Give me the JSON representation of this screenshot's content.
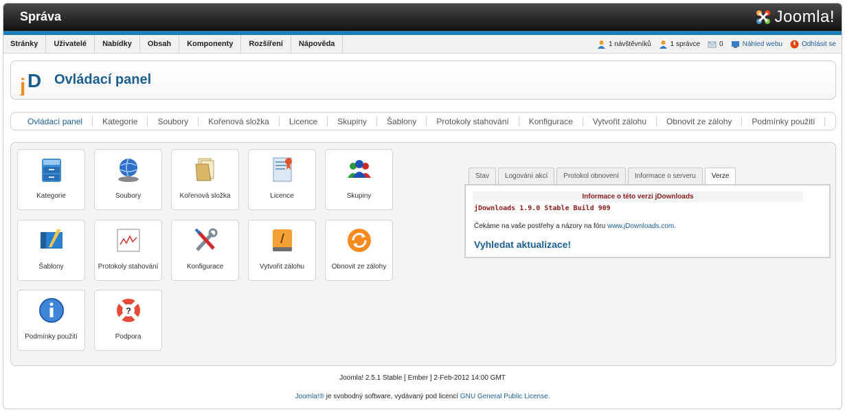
{
  "header": {
    "title": "Správa",
    "logo_text": "Joomla!"
  },
  "menu": [
    "Stránky",
    "Uživatelé",
    "Nabídky",
    "Obsah",
    "Komponenty",
    "Rozšíření",
    "Nápověda"
  ],
  "status": {
    "visitors": "1 návštěvníků",
    "admins": "1 správce",
    "messages": "0",
    "preview": "Náhled webu",
    "logout": "Odhlásit se"
  },
  "page": {
    "title": "Ovládací panel"
  },
  "submenu": [
    "Ovládací panel",
    "Kategorie",
    "Soubory",
    "Kořenová složka",
    "Licence",
    "Skupiny",
    "Šablony",
    "Protokoly stahování",
    "Konfigurace",
    "Vytvořit zálohu",
    "Obnovit ze zálohy",
    "Podmínky použití"
  ],
  "icons": {
    "kategorie": "Kategorie",
    "soubory": "Soubory",
    "korenova": "Kořenová složka",
    "licence": "Licence",
    "skupiny": "Skupiny",
    "sablony": "Šablony",
    "protokoly": "Protokoly stahování",
    "konfigurace": "Konfigurace",
    "zaloha": "Vytvořit zálohu",
    "obnovit": "Obnovit ze zálohy",
    "podminky": "Podmínky použití",
    "podpora": "Podpora"
  },
  "tabs": [
    "Stav",
    "Logování akcí",
    "Protokol obnovení",
    "Informace o serveru",
    "Verze"
  ],
  "version_panel": {
    "heading": "Informace o této verzi jDownloads",
    "version": "jDownloads 1.9.0 Stable Build 909",
    "feedback_text": "Čekáme na vaše postřehy a názory na fóru ",
    "feedback_link": "www.jDownloads.com",
    "feedback_end": ".",
    "update": "Vyhledat aktualizace!"
  },
  "footer": {
    "version": "Joomla! 2.5.1 Stable [ Ember ] 2-Feb-2012 14:00 GMT",
    "brand": "Joomla!®",
    "license_text": " je svobodný software, vydávaný pod licencí ",
    "license_link": "GNU General Public License",
    "end": "."
  }
}
